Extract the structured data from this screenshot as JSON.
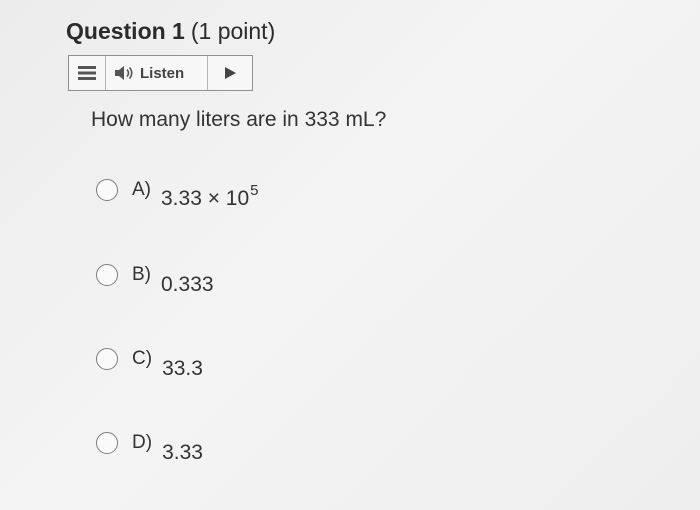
{
  "question": {
    "label": "Question 1",
    "points": "(1 point)",
    "prompt": "How many liters are in 333 mL?"
  },
  "toolbar": {
    "menu_icon": "hamburger-menu-icon",
    "listen_icon": "speaker-icon",
    "listen_label": "Listen",
    "play_icon": "play-icon"
  },
  "options": [
    {
      "letter": "A)",
      "value": "3.33 × 10",
      "exponent": "5"
    },
    {
      "letter": "B)",
      "value": "0.333"
    },
    {
      "letter": "C)",
      "value": "33.3"
    },
    {
      "letter": "D)",
      "value": "3.33"
    }
  ],
  "colors": {
    "text": "#2b2b2b",
    "border": "#8f8f8f",
    "radio": "#7c7c7c"
  }
}
